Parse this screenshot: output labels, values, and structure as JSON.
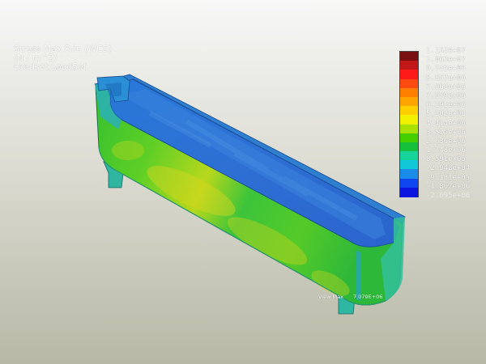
{
  "result_header": {
    "quantity": "Stress Max Prin (WCS)",
    "units": "(N / m^2)",
    "loadset": "Loadset:LoadSet"
  },
  "legend": {
    "labels": [
      "1.152e+07",
      "1.063e+07",
      "9.745e+06",
      "8.857e+06",
      "7.968e+06",
      "7.079e+06",
      "6.191e+06",
      "5.302e+06",
      "4.414e+06",
      "3.525e+06",
      "2.636e+06",
      "1.748e+06",
      "8.591e+05",
      "-2.948e+04",
      "-9.181e+05",
      "-1.807e+06",
      "-2.695e+06"
    ],
    "colors": [
      "#7a1010",
      "#c01818",
      "#ff1a1a",
      "#ff4a10",
      "#ff7f00",
      "#ffa500",
      "#ffd000",
      "#f0f000",
      "#a8e000",
      "#44d000",
      "#16c03c",
      "#16d49a",
      "#10c8d8",
      "#1a8ce8",
      "#1046f0",
      "#0c14e0"
    ]
  },
  "view_max": {
    "label": "View Max",
    "value": "7.079E+06"
  }
}
